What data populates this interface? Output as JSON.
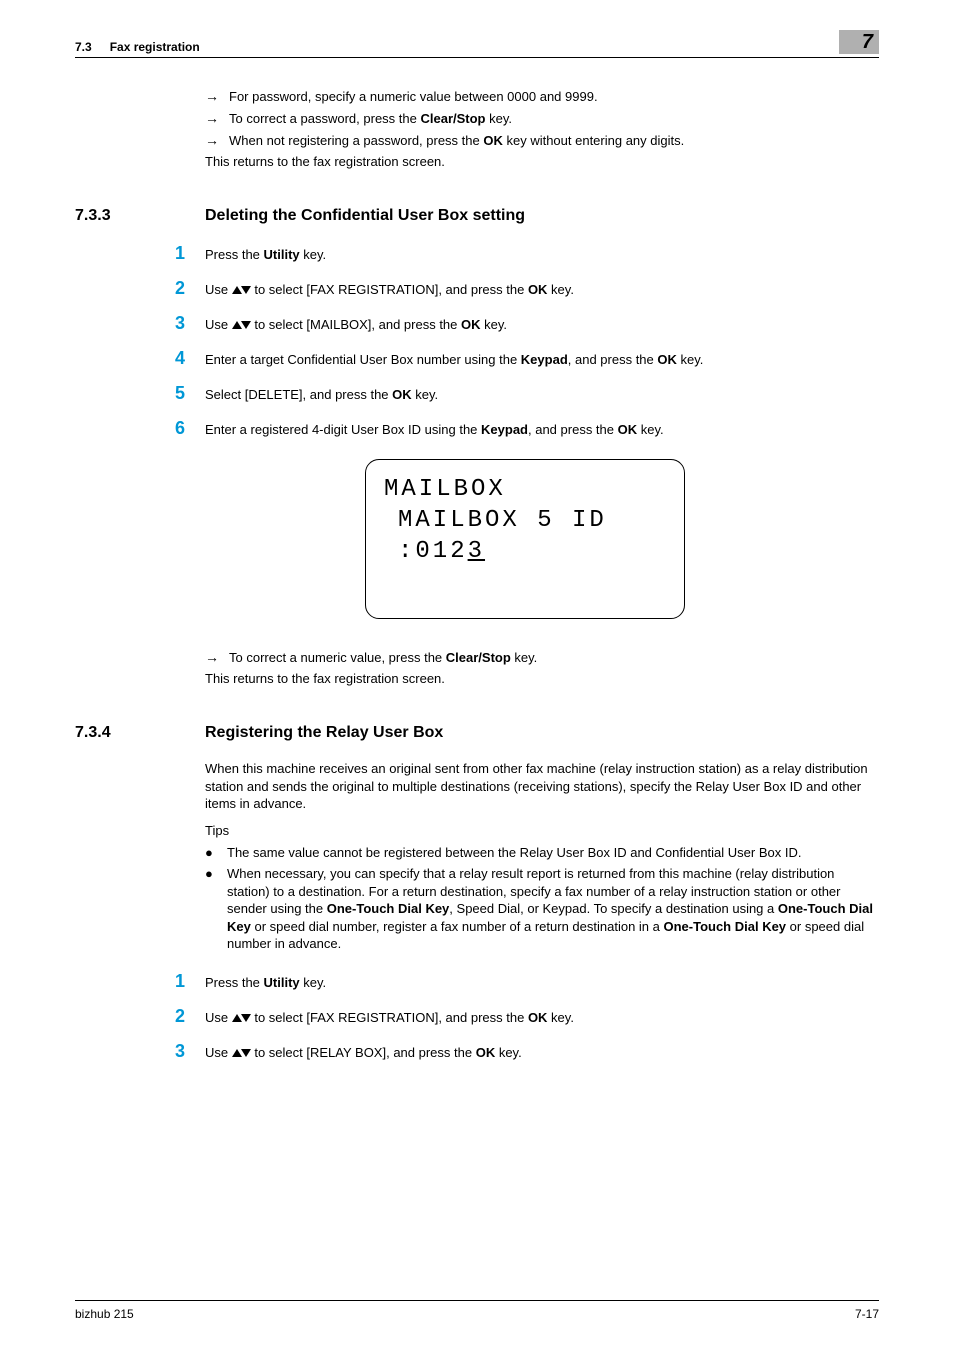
{
  "header": {
    "section_num": "7.3",
    "section_title": "Fax registration",
    "chapter_badge": "7"
  },
  "intro_arrows": [
    "For password, specify a numeric value between 0000 and 9999.",
    "To correct a password, press the ",
    "When not registering a password, press the "
  ],
  "intro_bold": {
    "clear_stop": "Clear/Stop",
    "ok": "OK"
  },
  "intro_arrow2_tail": " key.",
  "intro_arrow3_tail": " key without entering any digits.",
  "intro_plain": "This returns to the fax registration screen.",
  "sec733": {
    "num": "7.3.3",
    "title": "Deleting the Confidential User Box setting",
    "steps": [
      {
        "n": "1",
        "pre": "Press the ",
        "b1": "Utility",
        "post": " key."
      },
      {
        "n": "2",
        "pre": "Use ",
        "tri": true,
        "mid": " to select [FAX REGISTRATION], and press the ",
        "b1": "OK",
        "post": " key."
      },
      {
        "n": "3",
        "pre": "Use ",
        "tri": true,
        "mid": " to select [MAILBOX], and press the ",
        "b1": "OK",
        "post": " key."
      },
      {
        "n": "4",
        "pre": "Enter a target Confidential User Box number using the ",
        "b1": "Keypad",
        "mid2": ", and press the ",
        "b2": "OK",
        "post": " key."
      },
      {
        "n": "5",
        "pre": "Select [DELETE], and press the ",
        "b1": "OK",
        "post": " key."
      },
      {
        "n": "6",
        "pre": "Enter a registered 4-digit User Box ID using the ",
        "b1": "Keypad",
        "mid2": ", and press the ",
        "b2": "OK",
        "post": " key."
      }
    ],
    "lcd": {
      "line1": "MAILBOX",
      "line2": "MAILBOX 5 ID",
      "line3_prefix": ":012",
      "line3_cursor": "3"
    },
    "arrow_after": "To correct a numeric value, press the ",
    "arrow_after_bold": "Clear/Stop",
    "arrow_after_tail": " key.",
    "plain_after": "This returns to the fax registration screen."
  },
  "sec734": {
    "num": "7.3.4",
    "title": "Registering the Relay User Box",
    "para": "When this machine receives an original sent from other fax machine (relay instruction station) as a relay distribution station and sends the original to multiple destinations (receiving stations), specify the Relay User Box ID and other items in advance.",
    "tips_label": "Tips",
    "bullets": [
      {
        "text": "The same value cannot be registered between the Relay User Box ID and Confidential User Box ID."
      },
      {
        "pre": "When necessary, you can specify that a relay result report is returned from this machine (relay distribution station) to a destination. For a return destination, specify a fax number of a relay instruction station or other sender using the ",
        "b1": "One-Touch Dial Key",
        "mid": ", Speed Dial, or Keypad. To specify a destination using a ",
        "b2": "One-Touch Dial Key",
        "mid2": " or speed dial number, register a fax number of a return destination in a ",
        "b3": "One-Touch Dial Key",
        "post": " or speed dial number in advance."
      }
    ],
    "steps": [
      {
        "n": "1",
        "pre": "Press the ",
        "b1": "Utility",
        "post": " key."
      },
      {
        "n": "2",
        "pre": "Use ",
        "tri": true,
        "mid": " to select [FAX REGISTRATION], and press the ",
        "b1": "OK",
        "post": " key."
      },
      {
        "n": "3",
        "pre": "Use ",
        "tri": true,
        "mid": " to select [RELAY BOX], and press the ",
        "b1": "OK",
        "post": " key."
      }
    ]
  },
  "footer": {
    "left": "bizhub 215",
    "right": "7-17"
  }
}
